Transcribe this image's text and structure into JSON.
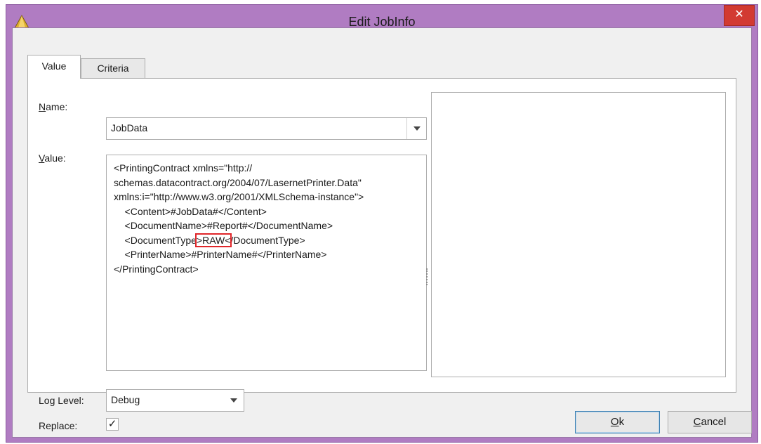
{
  "window": {
    "title": "Edit JobInfo",
    "close_glyph": "✕",
    "app_icon": "triangle-app-icon"
  },
  "tabs": [
    {
      "label": "Value",
      "selected": true
    },
    {
      "label": "Criteria",
      "selected": false
    }
  ],
  "form": {
    "name_label_u": "N",
    "name_label_rest": "ame:",
    "name_value": "JobData",
    "value_label_u": "V",
    "value_label_rest": "alue:",
    "value_lines": [
      "<PrintingContract xmlns=\"http://",
      "schemas.datacontract.org/2004/07/LasernetPrinter.Data\"",
      "xmlns:i=\"http://www.w3.org/2001/XMLSchema-instance\">",
      "    <Content>#JobData#</Content>",
      "    <DocumentName>#Report#</DocumentName>",
      "    <PrinterName>#PrinterName#</PrinterName>",
      "</PrintingContract>"
    ],
    "doc_type_prefix": "    <DocumentType",
    "doc_type_highlight": ">RAW<",
    "doc_type_suffix": "/DocumentType>",
    "log_level_label": "Log Level:",
    "log_level_value": "Debug",
    "replace_label": "Replace:",
    "replace_checked": "✓"
  },
  "buttons": {
    "ok_u": "O",
    "ok_rest": "k",
    "cancel_u": "C",
    "cancel_rest": "ancel"
  },
  "colors": {
    "titlebar": "#b07cc2",
    "close": "#d23a32",
    "highlight": "#e0262a"
  }
}
